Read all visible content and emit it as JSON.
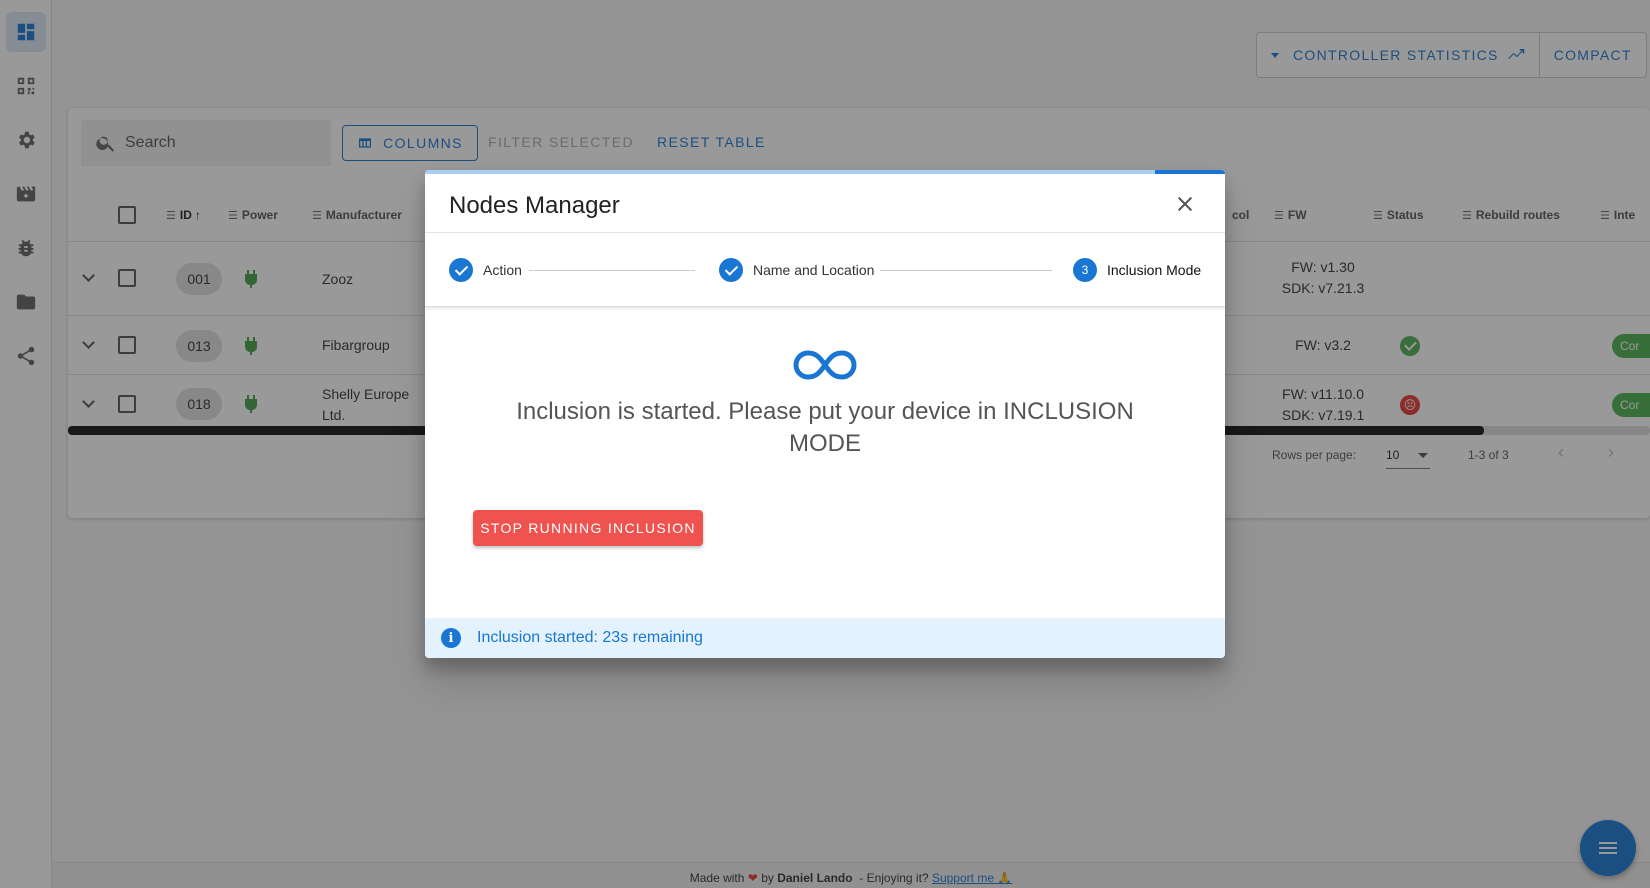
{
  "toolbar": {
    "controller_statistics": "CONTROLLER STATISTICS",
    "compact": "COMPACT"
  },
  "table_controls": {
    "search_placeholder": "Search",
    "columns": "COLUMNS",
    "filter_selected": "FILTER SELECTED",
    "reset_table": "RESET TABLE"
  },
  "columns": [
    "ID",
    "Power",
    "Manufacturer",
    "col",
    "FW",
    "Status",
    "Rebuild routes",
    "Inte"
  ],
  "rows": [
    {
      "id": "001",
      "manufacturer_line1": "Zooz",
      "manufacturer_line2": "",
      "fw_line1": "FW: v1.30",
      "fw_line2": "SDK: v7.21.3",
      "status": ""
    },
    {
      "id": "013",
      "manufacturer_line1": "Fibargroup",
      "manufacturer_line2": "",
      "fw_line1": "FW: v3.2",
      "fw_line2": "",
      "status": "ok",
      "chip": "Cor"
    },
    {
      "id": "018",
      "manufacturer_line1": "Shelly Europe",
      "manufacturer_line2": "Ltd.",
      "fw_line1": "FW: v11.10.0",
      "fw_line2": "SDK: v7.19.1",
      "status": "error",
      "chip": "Cor"
    }
  ],
  "pagination": {
    "rows_per_page_label": "Rows per page:",
    "rows_per_page_value": "10",
    "range": "1-3 of 3"
  },
  "dialog": {
    "title": "Nodes Manager",
    "steps": [
      {
        "label": "Action",
        "state": "done"
      },
      {
        "label": "Name and Location",
        "state": "done"
      },
      {
        "label": "Inclusion Mode",
        "state": "current",
        "number": "3"
      }
    ],
    "message": "Inclusion is started. Please put your device in INCLUSION MODE",
    "stop_button": "STOP RUNNING INCLUSION",
    "alert": "Inclusion started: 23s remaining"
  },
  "footer": {
    "made_with": "Made with",
    "by": "by",
    "author": "Daniel Lando",
    "enjoying": "- Enjoying it?",
    "support": "Support me 🙏"
  },
  "colors": {
    "primary": "#1976d2",
    "danger": "#ef5350",
    "success": "#4caf50",
    "alert_bg": "#e3f2fd"
  }
}
